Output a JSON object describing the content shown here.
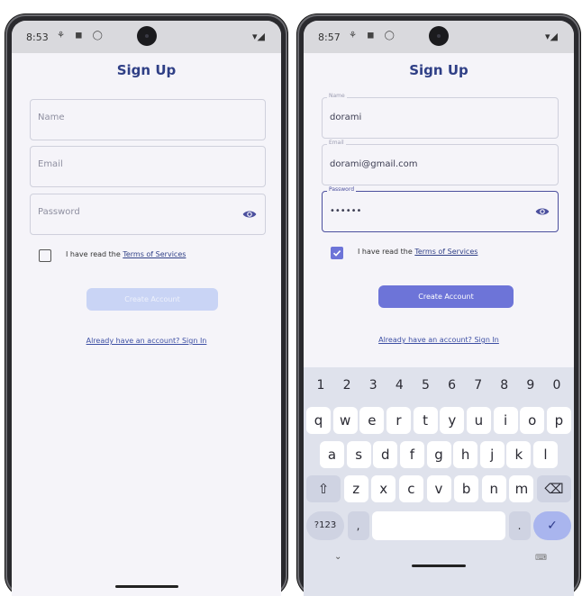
{
  "left": {
    "status": {
      "time": "8:53",
      "icons": "⚘ ◼ ◯",
      "right": "▾◢"
    },
    "title": "Sign Up",
    "fields": {
      "name_placeholder": "Name",
      "email_placeholder": "Email",
      "password_placeholder": "Password"
    },
    "checkbox": {
      "prefix": "I have read the ",
      "link": "Terms of Services",
      "checked": false
    },
    "button": {
      "label": "Create Account",
      "enabled": false
    },
    "signin_link": "Already have an account? Sign In"
  },
  "right": {
    "status": {
      "time": "8:57",
      "icons": "⚘ ◼ ◯",
      "right": "▾◢"
    },
    "title": "Sign Up",
    "fields": {
      "name_label": "Name",
      "name_value": "dorami",
      "email_label": "Email",
      "email_value": "dorami@gmail.com",
      "password_label": "Password",
      "password_value": "••••••"
    },
    "checkbox": {
      "prefix": "I have read the ",
      "link": "Terms of Services",
      "checked": true
    },
    "button": {
      "label": "Create Account",
      "enabled": true
    },
    "signin_link": "Already have an account? Sign In",
    "keyboard": {
      "numbers": [
        "1",
        "2",
        "3",
        "4",
        "5",
        "6",
        "7",
        "8",
        "9",
        "0"
      ],
      "row1": [
        "q",
        "w",
        "e",
        "r",
        "t",
        "y",
        "u",
        "i",
        "o",
        "p"
      ],
      "row2": [
        "a",
        "s",
        "d",
        "f",
        "g",
        "h",
        "j",
        "k",
        "l"
      ],
      "row3": [
        "z",
        "x",
        "c",
        "v",
        "b",
        "n",
        "m"
      ],
      "shift": "⇧",
      "backspace": "⌫",
      "symbols": "?123",
      "comma": ",",
      "period": ".",
      "enter": "✓",
      "collapse": "⌄",
      "keyboard_icon": "⌨"
    }
  },
  "colors": {
    "accent": "#6d74d8",
    "title": "#2f3f86",
    "disabled_button": "#c9d4f5"
  }
}
